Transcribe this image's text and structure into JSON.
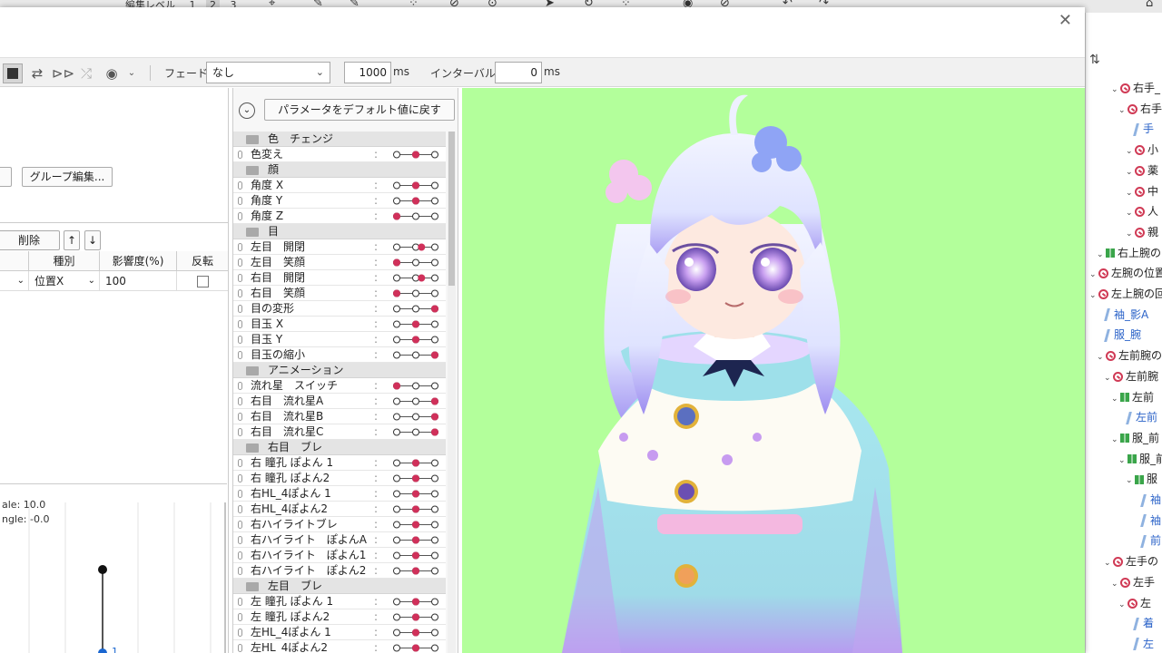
{
  "app_bar": {
    "edit_level_label": "編集レベル",
    "levels": [
      "1",
      "2",
      "3"
    ]
  },
  "toolbar": {
    "fade_label": "フェード：",
    "fade_value": "なし",
    "duration_value": "1000",
    "duration_unit": "ms",
    "interval_label": "インターバル：",
    "interval_value": "0",
    "interval_unit": "ms"
  },
  "left_panel": {
    "group_edit_button": "グループ編集...",
    "delete_button": "削除",
    "up_button": "↑",
    "down_button": "↓",
    "table_headers": [
      "種別",
      "影響度(%)",
      "反転"
    ],
    "row": {
      "kind": "位置X",
      "influence": "100",
      "invert": false
    },
    "graph_scale_text": "ale: 10.0",
    "graph_angle_text": "ngle: -0.0",
    "graph_point_label": "1"
  },
  "param_panel": {
    "reset_button": "パラメータをデフォルト値に戻す",
    "groups": [
      {
        "name": "色　チェンジ",
        "items": [
          {
            "name": "色変え",
            "value": 0.5
          }
        ]
      },
      {
        "name": "顔",
        "items": [
          {
            "name": "角度 X",
            "value": 0.5
          },
          {
            "name": "角度 Y",
            "value": 0.5
          },
          {
            "name": "角度 Z",
            "value": 0.0
          }
        ]
      },
      {
        "name": "目",
        "items": [
          {
            "name": "左目　開閉",
            "value": 0.65
          },
          {
            "name": "左目　笑顔",
            "value": 0.0
          },
          {
            "name": "右目　開閉",
            "value": 0.65
          },
          {
            "name": "右目　笑顔",
            "value": 0.0
          },
          {
            "name": "目の変形",
            "value": 1.0
          },
          {
            "name": "目玉 X",
            "value": 0.5
          },
          {
            "name": "目玉 Y",
            "value": 0.5
          },
          {
            "name": "目玉の縮小",
            "value": 1.0
          }
        ]
      },
      {
        "name": "アニメーション",
        "items": [
          {
            "name": "流れ星　スイッチ",
            "value": 0.0
          },
          {
            "name": "右目　流れ星A",
            "value": 1.0
          },
          {
            "name": "右目　流れ星B",
            "value": 1.0
          },
          {
            "name": "右目　流れ星C",
            "value": 1.0
          }
        ]
      },
      {
        "name": "右目　ブレ",
        "items": [
          {
            "name": "右 瞳孔 ぽよん 1",
            "value": 0.5
          },
          {
            "name": "右 瞳孔 ぽよん2",
            "value": 0.5
          },
          {
            "name": "右HL_4ぽよん 1",
            "value": 0.5
          },
          {
            "name": "右HL_4ぽよん2",
            "value": 0.5
          },
          {
            "name": "右ハイライトブレ",
            "value": 0.5
          },
          {
            "name": "右ハイライト　ぽよんA",
            "value": 0.5
          },
          {
            "name": "右ハイライト　ぽよん1",
            "value": 0.5
          },
          {
            "name": "右ハイライト　ぽよん2",
            "value": 0.5
          }
        ]
      },
      {
        "name": "左目　ブレ",
        "items": [
          {
            "name": "左 瞳孔 ぽよん 1",
            "value": 0.5
          },
          {
            "name": "左 瞳孔 ぽよん2",
            "value": 0.5
          },
          {
            "name": "左HL_4ぽよん 1",
            "value": 0.5
          },
          {
            "name": "左HL_4ぽよん2",
            "value": 0.5
          }
        ]
      }
    ]
  },
  "parts_tree": [
    {
      "label": "右手_",
      "icon": "rotation",
      "depth": 3,
      "blue": false
    },
    {
      "label": "右手",
      "icon": "rotation",
      "depth": 4,
      "blue": false
    },
    {
      "label": "手",
      "icon": "art",
      "depth": 5,
      "blue": true
    },
    {
      "label": "小",
      "icon": "rotation",
      "depth": 5,
      "blue": false
    },
    {
      "label": "薬",
      "icon": "rotation",
      "depth": 5,
      "blue": false
    },
    {
      "label": "中",
      "icon": "rotation",
      "depth": 5,
      "blue": false
    },
    {
      "label": "人",
      "icon": "rotation",
      "depth": 5,
      "blue": false
    },
    {
      "label": "親",
      "icon": "rotation",
      "depth": 5,
      "blue": false
    },
    {
      "label": "右上腕の",
      "icon": "group",
      "depth": 1,
      "blue": false
    },
    {
      "label": "左腕の位置",
      "icon": "rotation",
      "depth": 0,
      "blue": false
    },
    {
      "label": "左上腕の回",
      "icon": "rotation",
      "depth": 0,
      "blue": false
    },
    {
      "label": "袖_影A",
      "icon": "art",
      "depth": 1,
      "blue": true
    },
    {
      "label": "服_腕",
      "icon": "art",
      "depth": 1,
      "blue": true
    },
    {
      "label": "左前腕の",
      "icon": "rotation",
      "depth": 1,
      "blue": false
    },
    {
      "label": "左前腕",
      "icon": "rotation",
      "depth": 2,
      "blue": false
    },
    {
      "label": "左前",
      "icon": "group",
      "depth": 3,
      "blue": false
    },
    {
      "label": "左前",
      "icon": "art",
      "depth": 4,
      "blue": true
    },
    {
      "label": "服_前",
      "icon": "group",
      "depth": 3,
      "blue": false
    },
    {
      "label": "服_前",
      "icon": "group",
      "depth": 4,
      "blue": false
    },
    {
      "label": "服",
      "icon": "group",
      "depth": 5,
      "blue": false
    },
    {
      "label": "袖",
      "icon": "art",
      "depth": 6,
      "blue": true
    },
    {
      "label": "袖",
      "icon": "art",
      "depth": 6,
      "blue": true
    },
    {
      "label": "前",
      "icon": "art",
      "depth": 6,
      "blue": true
    },
    {
      "label": "左手の",
      "icon": "rotation",
      "depth": 2,
      "blue": false
    },
    {
      "label": "左手",
      "icon": "rotation",
      "depth": 3,
      "blue": false
    },
    {
      "label": "左",
      "icon": "rotation",
      "depth": 4,
      "blue": false
    },
    {
      "label": "着",
      "icon": "art",
      "depth": 5,
      "blue": true
    },
    {
      "label": "左",
      "icon": "art",
      "depth": 5,
      "blue": true
    }
  ],
  "colors": {
    "viewport_bg": "#b3ff9b",
    "slider_active": "#d0305a",
    "tree_link": "#2a62c8"
  }
}
